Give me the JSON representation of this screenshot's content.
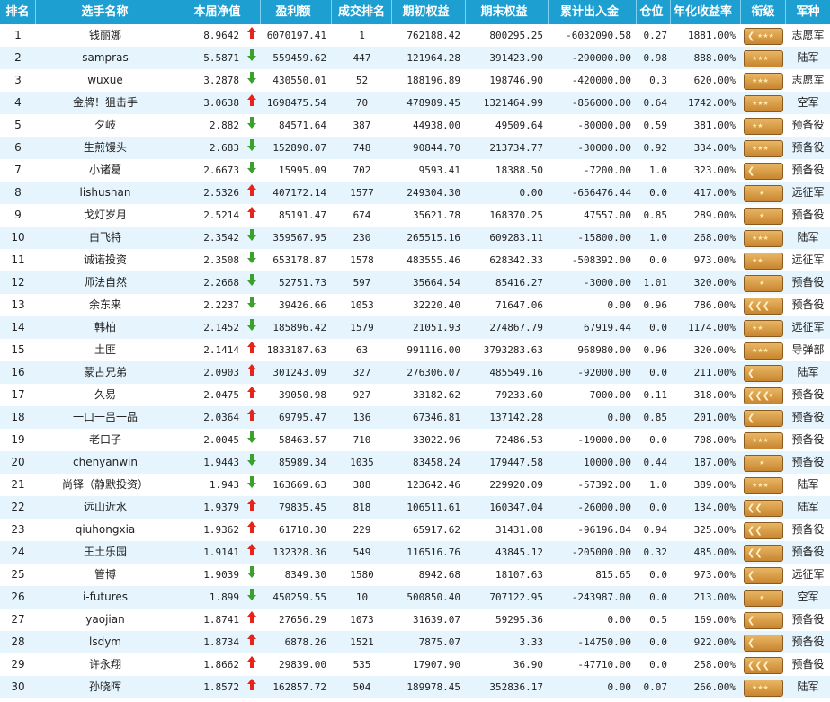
{
  "headers": [
    "排名",
    "选手名称",
    "本届净值",
    "盈利额",
    "成交排名",
    "期初权益",
    "期末权益",
    "累计出入金",
    "仓位",
    "年化收益率",
    "衔级",
    "军种"
  ],
  "rows": [
    {
      "rank": "1",
      "name": "钱丽娜",
      "nav": "8.9642",
      "dir": "up",
      "profit": "6070197.41",
      "trade_rank": "1",
      "begin": "762188.42",
      "end": "800295.25",
      "flow": "-6032090.58",
      "pos": "0.27",
      "annual": "1881.00%",
      "badge": "chev-stars",
      "army": "志愿军"
    },
    {
      "rank": "2",
      "name": "sampras",
      "nav": "5.5871",
      "dir": "down",
      "profit": "559459.62",
      "trade_rank": "447",
      "begin": "121964.28",
      "end": "391423.90",
      "flow": "-290000.00",
      "pos": "0.98",
      "annual": "888.00%",
      "badge": "stars3",
      "army": "陆军"
    },
    {
      "rank": "3",
      "name": "wuxue",
      "nav": "3.2878",
      "dir": "down",
      "profit": "430550.01",
      "trade_rank": "52",
      "begin": "188196.89",
      "end": "198746.90",
      "flow": "-420000.00",
      "pos": "0.3",
      "annual": "620.00%",
      "badge": "stars3",
      "army": "志愿军"
    },
    {
      "rank": "4",
      "name": "金牌！狙击手",
      "nav": "3.0638",
      "dir": "up",
      "profit": "1698475.54",
      "trade_rank": "70",
      "begin": "478989.45",
      "end": "1321464.99",
      "flow": "-856000.00",
      "pos": "0.64",
      "annual": "1742.00%",
      "badge": "stars3",
      "army": "空军"
    },
    {
      "rank": "5",
      "name": "夕岐",
      "nav": "2.882",
      "dir": "down",
      "profit": "84571.64",
      "trade_rank": "387",
      "begin": "44938.00",
      "end": "49509.64",
      "flow": "-80000.00",
      "pos": "0.59",
      "annual": "381.00%",
      "badge": "stars2",
      "army": "预备役"
    },
    {
      "rank": "6",
      "name": "生煎馒头",
      "nav": "2.683",
      "dir": "down",
      "profit": "152890.07",
      "trade_rank": "748",
      "begin": "90844.70",
      "end": "213734.77",
      "flow": "-30000.00",
      "pos": "0.92",
      "annual": "334.00%",
      "badge": "stars3",
      "army": "预备役"
    },
    {
      "rank": "7",
      "name": "小诸葛",
      "nav": "2.6673",
      "dir": "down",
      "profit": "15995.09",
      "trade_rank": "702",
      "begin": "9593.41",
      "end": "18388.50",
      "flow": "-7200.00",
      "pos": "1.0",
      "annual": "323.00%",
      "badge": "chev1",
      "army": "预备役"
    },
    {
      "rank": "8",
      "name": "lishushan",
      "nav": "2.5326",
      "dir": "up",
      "profit": "407172.14",
      "trade_rank": "1577",
      "begin": "249304.30",
      "end": "0.00",
      "flow": "-656476.44",
      "pos": "0.0",
      "annual": "417.00%",
      "badge": "stars1",
      "army": "远征军"
    },
    {
      "rank": "9",
      "name": "戈灯岁月",
      "nav": "2.5214",
      "dir": "up",
      "profit": "85191.47",
      "trade_rank": "674",
      "begin": "35621.78",
      "end": "168370.25",
      "flow": "47557.00",
      "pos": "0.85",
      "annual": "289.00%",
      "badge": "stars1",
      "army": "预备役"
    },
    {
      "rank": "10",
      "name": "白飞特",
      "nav": "2.3542",
      "dir": "down",
      "profit": "359567.95",
      "trade_rank": "230",
      "begin": "265515.16",
      "end": "609283.11",
      "flow": "-15800.00",
      "pos": "1.0",
      "annual": "268.00%",
      "badge": "stars3",
      "army": "陆军"
    },
    {
      "rank": "11",
      "name": "诚诺投资",
      "nav": "2.3508",
      "dir": "down",
      "profit": "653178.87",
      "trade_rank": "1578",
      "begin": "483555.46",
      "end": "628342.33",
      "flow": "-508392.00",
      "pos": "0.0",
      "annual": "973.00%",
      "badge": "stars2",
      "army": "远征军"
    },
    {
      "rank": "12",
      "name": "师法自然",
      "nav": "2.2668",
      "dir": "down",
      "profit": "52751.73",
      "trade_rank": "597",
      "begin": "35664.54",
      "end": "85416.27",
      "flow": "-3000.00",
      "pos": "1.01",
      "annual": "320.00%",
      "badge": "stars1",
      "army": "预备役"
    },
    {
      "rank": "13",
      "name": "余东来",
      "nav": "2.2237",
      "dir": "down",
      "profit": "39426.66",
      "trade_rank": "1053",
      "begin": "32220.40",
      "end": "71647.06",
      "flow": "0.00",
      "pos": "0.96",
      "annual": "786.00%",
      "badge": "chev3",
      "army": "预备役"
    },
    {
      "rank": "14",
      "name": "韩柏",
      "nav": "2.1452",
      "dir": "down",
      "profit": "185896.42",
      "trade_rank": "1579",
      "begin": "21051.93",
      "end": "274867.79",
      "flow": "67919.44",
      "pos": "0.0",
      "annual": "1174.00%",
      "badge": "stars2",
      "army": "远征军"
    },
    {
      "rank": "15",
      "name": "土匪",
      "nav": "2.1414",
      "dir": "up",
      "profit": "1833187.63",
      "trade_rank": "63",
      "begin": "991116.00",
      "end": "3793283.63",
      "flow": "968980.00",
      "pos": "0.96",
      "annual": "320.00%",
      "badge": "stars3",
      "army": "导弹部"
    },
    {
      "rank": "16",
      "name": "蒙古兄弟",
      "nav": "2.0903",
      "dir": "up",
      "profit": "301243.09",
      "trade_rank": "327",
      "begin": "276306.07",
      "end": "485549.16",
      "flow": "-92000.00",
      "pos": "0.0",
      "annual": "211.00%",
      "badge": "chev1",
      "army": "陆军"
    },
    {
      "rank": "17",
      "name": "久易",
      "nav": "2.0475",
      "dir": "up",
      "profit": "39050.98",
      "trade_rank": "927",
      "begin": "33182.62",
      "end": "79233.60",
      "flow": "7000.00",
      "pos": "0.11",
      "annual": "318.00%",
      "badge": "chev3star",
      "army": "预备役"
    },
    {
      "rank": "18",
      "name": "一口一吕一品",
      "nav": "2.0364",
      "dir": "up",
      "profit": "69795.47",
      "trade_rank": "136",
      "begin": "67346.81",
      "end": "137142.28",
      "flow": "0.00",
      "pos": "0.85",
      "annual": "201.00%",
      "badge": "chev1",
      "army": "预备役"
    },
    {
      "rank": "19",
      "name": "老口子",
      "nav": "2.0045",
      "dir": "down",
      "profit": "58463.57",
      "trade_rank": "710",
      "begin": "33022.96",
      "end": "72486.53",
      "flow": "-19000.00",
      "pos": "0.0",
      "annual": "708.00%",
      "badge": "stars3",
      "army": "预备役"
    },
    {
      "rank": "20",
      "name": "chenyanwin",
      "nav": "1.9443",
      "dir": "down",
      "profit": "85989.34",
      "trade_rank": "1035",
      "begin": "83458.24",
      "end": "179447.58",
      "flow": "10000.00",
      "pos": "0.44",
      "annual": "187.00%",
      "badge": "stars1",
      "army": "预备役"
    },
    {
      "rank": "21",
      "name": "尚铎（静默投资）",
      "nav": "1.943",
      "dir": "down",
      "profit": "163669.63",
      "trade_rank": "388",
      "begin": "123642.46",
      "end": "229920.09",
      "flow": "-57392.00",
      "pos": "1.0",
      "annual": "389.00%",
      "badge": "stars3",
      "army": "陆军"
    },
    {
      "rank": "22",
      "name": "远山近水",
      "nav": "1.9379",
      "dir": "up",
      "profit": "79835.45",
      "trade_rank": "818",
      "begin": "106511.61",
      "end": "160347.04",
      "flow": "-26000.00",
      "pos": "0.0",
      "annual": "134.00%",
      "badge": "chev2",
      "army": "陆军"
    },
    {
      "rank": "23",
      "name": "qiuhongxia",
      "nav": "1.9362",
      "dir": "up",
      "profit": "61710.30",
      "trade_rank": "229",
      "begin": "65917.62",
      "end": "31431.08",
      "flow": "-96196.84",
      "pos": "0.94",
      "annual": "325.00%",
      "badge": "chev2",
      "army": "预备役"
    },
    {
      "rank": "24",
      "name": "王土乐园",
      "nav": "1.9141",
      "dir": "up",
      "profit": "132328.36",
      "trade_rank": "549",
      "begin": "116516.76",
      "end": "43845.12",
      "flow": "-205000.00",
      "pos": "0.32",
      "annual": "485.00%",
      "badge": "chev2",
      "army": "预备役"
    },
    {
      "rank": "25",
      "name": "管博",
      "nav": "1.9039",
      "dir": "down",
      "profit": "8349.30",
      "trade_rank": "1580",
      "begin": "8942.68",
      "end": "18107.63",
      "flow": "815.65",
      "pos": "0.0",
      "annual": "973.00%",
      "badge": "chev1",
      "army": "远征军"
    },
    {
      "rank": "26",
      "name": "i-futures",
      "nav": "1.899",
      "dir": "down",
      "profit": "450259.55",
      "trade_rank": "10",
      "begin": "500850.40",
      "end": "707122.95",
      "flow": "-243987.00",
      "pos": "0.0",
      "annual": "213.00%",
      "badge": "stars1",
      "army": "空军"
    },
    {
      "rank": "27",
      "name": "yaojian",
      "nav": "1.8741",
      "dir": "up",
      "profit": "27656.29",
      "trade_rank": "1073",
      "begin": "31639.07",
      "end": "59295.36",
      "flow": "0.00",
      "pos": "0.5",
      "annual": "169.00%",
      "badge": "chev1",
      "army": "预备役"
    },
    {
      "rank": "28",
      "name": "lsdym",
      "nav": "1.8734",
      "dir": "up",
      "profit": "6878.26",
      "trade_rank": "1521",
      "begin": "7875.07",
      "end": "3.33",
      "flow": "-14750.00",
      "pos": "0.0",
      "annual": "922.00%",
      "badge": "chev1",
      "army": "预备役"
    },
    {
      "rank": "29",
      "name": "许永翔",
      "nav": "1.8662",
      "dir": "up",
      "profit": "29839.00",
      "trade_rank": "535",
      "begin": "17907.90",
      "end": "36.90",
      "flow": "-47710.00",
      "pos": "0.0",
      "annual": "258.00%",
      "badge": "chev3",
      "army": "预备役"
    },
    {
      "rank": "30",
      "name": "孙晓晖",
      "nav": "1.8572",
      "dir": "up",
      "profit": "162857.72",
      "trade_rank": "504",
      "begin": "189978.45",
      "end": "352836.17",
      "flow": "0.00",
      "pos": "0.07",
      "annual": "266.00%",
      "badge": "stars3",
      "army": "陆军"
    }
  ],
  "colors": {
    "header_bg": "#1e9fd2",
    "row_alt": "#e6f5fd",
    "arrow_up": "#e8231c",
    "arrow_down": "#3aa12c",
    "badge_gold": "#d89a45"
  }
}
